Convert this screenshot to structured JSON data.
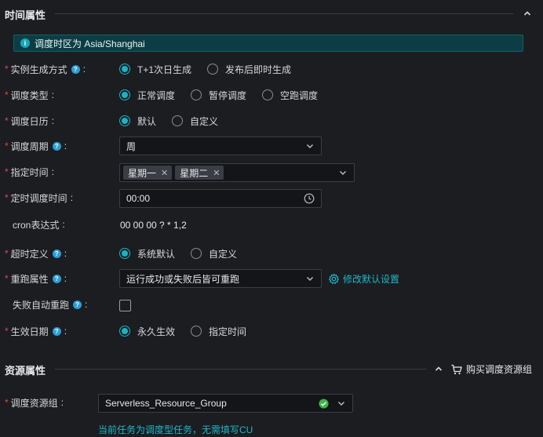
{
  "sections": {
    "time": {
      "title": "时间属性"
    },
    "resource": {
      "title": "资源属性",
      "buy_label": "购买调度资源组"
    }
  },
  "banner": {
    "text": "调度时区为 Asia/Shanghai"
  },
  "form": {
    "instance_gen": {
      "label": "实例生成方式",
      "options": [
        "T+1次日生成",
        "发布后即时生成"
      ],
      "selected": 0
    },
    "schedule_type": {
      "label": "调度类型",
      "options": [
        "正常调度",
        "暂停调度",
        "空跑调度"
      ],
      "selected": 0
    },
    "calendar": {
      "label": "调度日历",
      "options": [
        "默认",
        "自定义"
      ],
      "selected": 0
    },
    "cycle": {
      "label": "调度周期",
      "value": "周"
    },
    "specified_time": {
      "label": "指定时间",
      "tags": [
        "星期一",
        "星期二"
      ]
    },
    "cron_time": {
      "label": "定时调度时间",
      "value": "00:00"
    },
    "cron_expr": {
      "label": "cron表达式",
      "value": "00 00 00 ? * 1,2"
    },
    "timeout": {
      "label": "超时定义",
      "options": [
        "系统默认",
        "自定义"
      ],
      "selected": 0
    },
    "rerun": {
      "label": "重跑属性",
      "value": "运行成功或失败后皆可重跑",
      "link": "修改默认设置"
    },
    "auto_rerun": {
      "label": "失败自动重跑",
      "checked": false
    },
    "effective_date": {
      "label": "生效日期",
      "options": [
        "永久生效",
        "指定时间"
      ],
      "selected": 0
    },
    "resource_group": {
      "label": "调度资源组",
      "value": "Serverless_Resource_Group",
      "hint": "当前任务为调度型任务，无需填写CU"
    }
  },
  "colors": {
    "accent": "#17b4c4",
    "required": "#e04a3f",
    "status_ok": "#3cb34a",
    "background": "#1c1d21"
  }
}
